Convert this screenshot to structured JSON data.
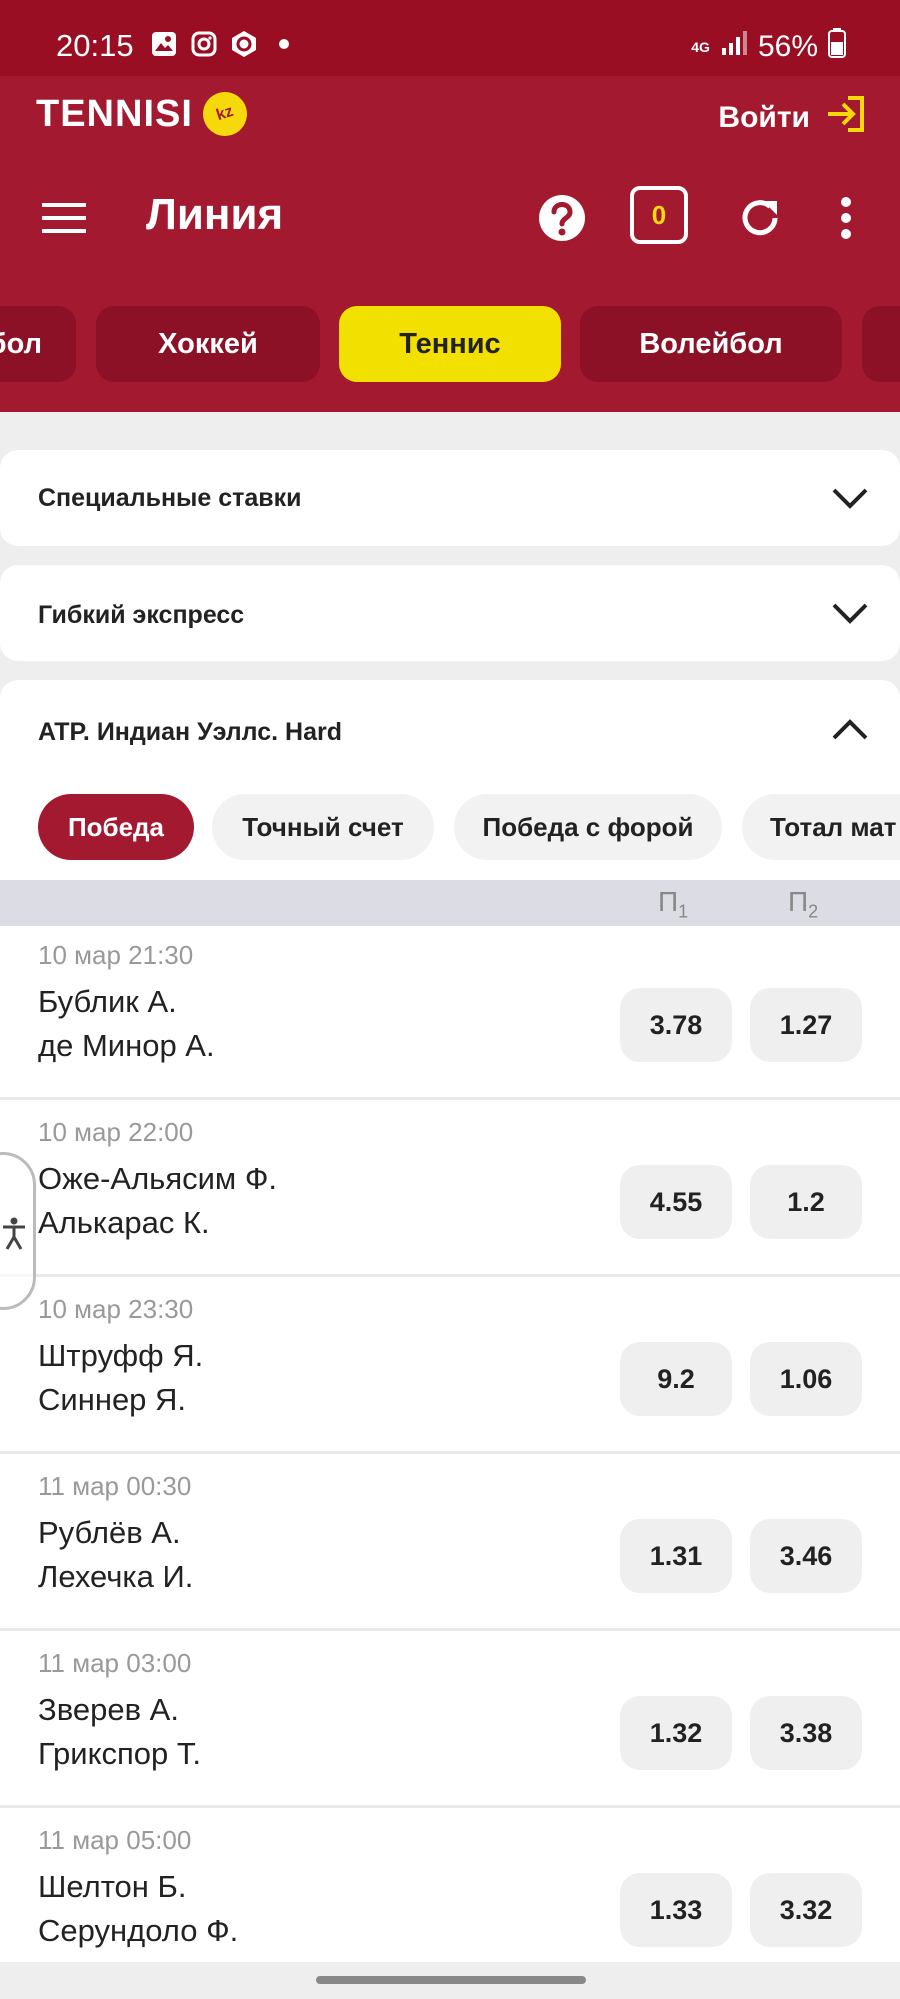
{
  "status_bar": {
    "time": "20:15",
    "network": "4G",
    "battery": "56%",
    "icons": [
      "gallery-icon",
      "instagram-icon",
      "crypto-icon",
      "dot-icon",
      "signal-icon",
      "battery-icon"
    ]
  },
  "brand": {
    "name": "TENNISI",
    "badge": "kz",
    "login_label": "Войти"
  },
  "toolbar": {
    "title": "Линия",
    "coupon_count": "0"
  },
  "sports_tabs": [
    {
      "label": "бол",
      "active": false
    },
    {
      "label": "Хоккей",
      "active": false
    },
    {
      "label": "Теннис",
      "active": true
    },
    {
      "label": "Волейбол",
      "active": false
    }
  ],
  "sections": {
    "special_bets": "Специальные ставки",
    "flex_express": "Гибкий экспресс",
    "tournament": "ATP. Индиан Уэллс. Hard"
  },
  "market_tabs": [
    {
      "label": "Победа",
      "active": true
    },
    {
      "label": "Точный счет",
      "active": false
    },
    {
      "label": "Победа с форой",
      "active": false
    },
    {
      "label": "Тотал мат",
      "active": false
    }
  ],
  "columns": {
    "p": "П",
    "p1_sub": "1",
    "p2_sub": "2"
  },
  "matches": [
    {
      "time": "10 мар 21:30",
      "player1": "Бублик А.",
      "player2": "де Минор А.",
      "odd1": "3.78",
      "odd2": "1.27"
    },
    {
      "time": "10 мар 22:00",
      "player1": "Оже-Альясим Ф.",
      "player2": "Алькарас К.",
      "odd1": "4.55",
      "odd2": "1.2"
    },
    {
      "time": "10 мар 23:30",
      "player1": "Штруфф Я.",
      "player2": "Синнер Я.",
      "odd1": "9.2",
      "odd2": "1.06"
    },
    {
      "time": "11 мар 00:30",
      "player1": "Рублёв А.",
      "player2": "Лехечка И.",
      "odd1": "1.31",
      "odd2": "3.46"
    },
    {
      "time": "11 мар 03:00",
      "player1": "Зверев А.",
      "player2": "Грикспор Т.",
      "odd1": "1.32",
      "odd2": "3.38"
    },
    {
      "time": "11 мар 05:00",
      "player1": "Шелтон Б.",
      "player2": "Серундоло Ф.",
      "odd1": "1.33",
      "odd2": "3.32"
    }
  ],
  "colors": {
    "brand_red": "#a31a30",
    "status_red": "#9a0e24",
    "accent_yellow": "#f1e000"
  }
}
